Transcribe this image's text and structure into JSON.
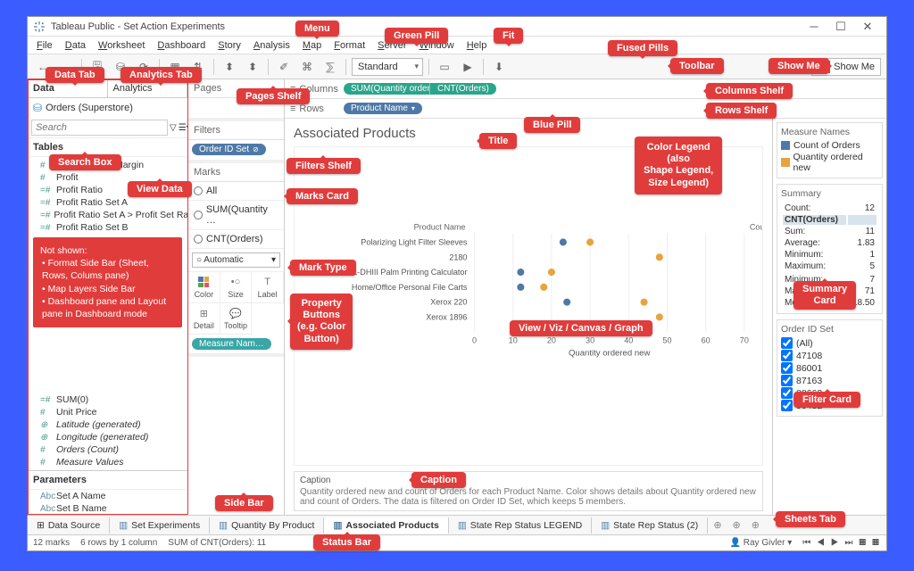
{
  "window": {
    "title": "Tableau Public - Set Action Experiments"
  },
  "menu": [
    "File",
    "Data",
    "Worksheet",
    "Dashboard",
    "Story",
    "Analysis",
    "Map",
    "Format",
    "Server",
    "Window",
    "Help"
  ],
  "toolbar": {
    "fit": "Standard",
    "showme": "Show Me"
  },
  "sidebar": {
    "tabs": {
      "data": "Data",
      "analytics": "Analytics"
    },
    "datasource": "Orders (Superstore)",
    "search_placeholder": "Search",
    "tables_header": "Tables",
    "fields_top": [
      {
        "t": "#",
        "n": "Product Base Margin"
      },
      {
        "t": "#",
        "n": "Profit"
      },
      {
        "t": "=#",
        "n": "Profit Ratio"
      },
      {
        "t": "=#",
        "n": "Profit Ratio Set A"
      },
      {
        "t": "=#",
        "n": "Profit Ratio Set A > Profit Set Ratio B"
      },
      {
        "t": "=#",
        "n": "Profit Ratio Set B"
      }
    ],
    "note": {
      "heading": "Not shown:",
      "items": [
        "Format Side Bar (Sheet, Rows, Colums pane)",
        "Map Layers Side Bar",
        "Dashboard pane and Layout pane in Dashboard mode"
      ]
    },
    "fields_bottom": [
      {
        "t": "=#",
        "n": "SUM(0)"
      },
      {
        "t": "#",
        "n": "Unit Price"
      },
      {
        "t": "⊕",
        "n": "Latitude (generated)",
        "i": true
      },
      {
        "t": "⊕",
        "n": "Longitude (generated)",
        "i": true
      },
      {
        "t": "#",
        "n": "Orders (Count)",
        "i": true
      },
      {
        "t": "#",
        "n": "Measure Values",
        "i": true
      }
    ],
    "params_header": "Parameters",
    "params": [
      {
        "t": "Abc",
        "n": "Set A Name"
      },
      {
        "t": "Abc",
        "n": "Set B Name"
      }
    ]
  },
  "middle": {
    "pages": "Pages",
    "filters": "Filters",
    "filter_pill": "Order ID Set",
    "marks": "Marks",
    "mark_rows": [
      "All",
      "SUM(Quantity …",
      "CNT(Orders)"
    ],
    "mark_type": "Automatic",
    "props": [
      "Color",
      "Size",
      "Label",
      "Detail",
      "Tooltip"
    ],
    "mark_pill": "Measure Nam…"
  },
  "shelves": {
    "columns_label": "Columns",
    "rows_label": "Rows",
    "col_pills": [
      "SUM(Quantity ordere…",
      "CNT(Orders)"
    ],
    "row_pill": "Product Name"
  },
  "viz": {
    "title": "Associated Products",
    "header_col": "Product Name",
    "header_extra": "Cou…",
    "rows": [
      "Polarizing Light Filter Sleeves",
      "2180",
      "Canon P1-DHIII Palm Printing Calculator",
      "Home/Office Personal File Carts",
      "Xerox 220",
      "Xerox 1896"
    ],
    "xlabel": "Quantity ordered new",
    "ticks": [
      0,
      10,
      20,
      30,
      40,
      50,
      60,
      70
    ],
    "caption_label": "Caption",
    "caption_text": "Quantity ordered new and count of Orders for each Product Name.  Color shows details about Quantity ordered new and count of Orders.  The data is filtered on Order ID Set, which keeps 5 members."
  },
  "chart_data": {
    "type": "scatter",
    "xlabel": "Quantity ordered new",
    "xlim": [
      0,
      70
    ],
    "series": [
      {
        "name": "Count of Orders",
        "color": "#4e79a7"
      },
      {
        "name": "Quantity ordered new",
        "color": "#e8a33d"
      }
    ],
    "rows": [
      {
        "name": "Polarizing Light Filter Sleeves",
        "points": [
          {
            "x": 23,
            "s": 0
          },
          {
            "x": 30,
            "s": 1
          }
        ]
      },
      {
        "name": "2180",
        "points": [
          {
            "x": 48,
            "s": 1
          }
        ]
      },
      {
        "name": "Canon P1-DHIII Palm Printing Calculator",
        "points": [
          {
            "x": 12,
            "s": 0
          },
          {
            "x": 20,
            "s": 1
          }
        ]
      },
      {
        "name": "Home/Office Personal File Carts",
        "points": [
          {
            "x": 12,
            "s": 0
          },
          {
            "x": 18,
            "s": 1
          }
        ]
      },
      {
        "name": "Xerox 220",
        "points": [
          {
            "x": 24,
            "s": 0
          },
          {
            "x": 44,
            "s": 1
          }
        ]
      },
      {
        "name": "Xerox 1896",
        "points": [
          {
            "x": 48,
            "s": 1
          }
        ]
      }
    ]
  },
  "rpanel": {
    "legend_title": "Measure Names",
    "legend": [
      {
        "c": "#4e79a7",
        "l": "Count of Orders"
      },
      {
        "c": "#e8a33d",
        "l": "Quantity ordered new"
      }
    ],
    "summary_title": "Summary",
    "summary_rows": [
      [
        "Count:",
        "12"
      ],
      [
        "CNT(Orders)",
        ""
      ],
      [
        "Sum:",
        "11"
      ],
      [
        "Average:",
        "1.83"
      ],
      [
        "Minimum:",
        "1"
      ],
      [
        "Maximum:",
        "5"
      ],
      [
        "",
        ""
      ],
      [
        "Minimum:",
        "7"
      ],
      [
        "Maximum:",
        "71"
      ],
      [
        "Median:",
        "18.50"
      ]
    ],
    "filter_title": "Order ID Set",
    "filter_items": [
      "(All)",
      "47108",
      "86001",
      "87163",
      "88662",
      "90482"
    ]
  },
  "tabs": {
    "list": [
      "Data Source",
      "Set Experiments",
      "Quantity By Product",
      "Associated Products",
      "State Rep Status LEGEND",
      "State Rep Status (2)"
    ],
    "active": 3
  },
  "status": {
    "marks": "12 marks",
    "layout": "6 rows by 1 column",
    "agg": "SUM of CNT(Orders): 11",
    "user": "Ray Givler"
  },
  "annotations": {
    "menu": "Menu",
    "green_pill": "Green Pill",
    "fit": "Fit",
    "fused": "Fused Pills",
    "toolbar": "Toolbar",
    "showme": "Show Me",
    "data_tab": "Data Tab",
    "analytics_tab": "Analytics Tab",
    "pages": "Pages Shelf",
    "cols": "Columns Shelf",
    "rows": "Rows Shelf",
    "blue_pill": "Blue Pill",
    "title": "Title",
    "legend": "Color Legend\n(also\nShape Legend,\nSize Legend)",
    "search": "Search Box",
    "view_data": "View Data",
    "filters": "Filters Shelf",
    "marks": "Marks Card",
    "mark_type": "Mark Type",
    "props": "Property\nButtons\n(e.g. Color\nButton)",
    "view": "View / Viz / Canvas / Graph",
    "summary": "Summary\nCard",
    "filter_card": "Filter Card",
    "caption": "Caption",
    "sidebar": "Side Bar",
    "sheets": "Sheets Tab",
    "status": "Status Bar"
  }
}
